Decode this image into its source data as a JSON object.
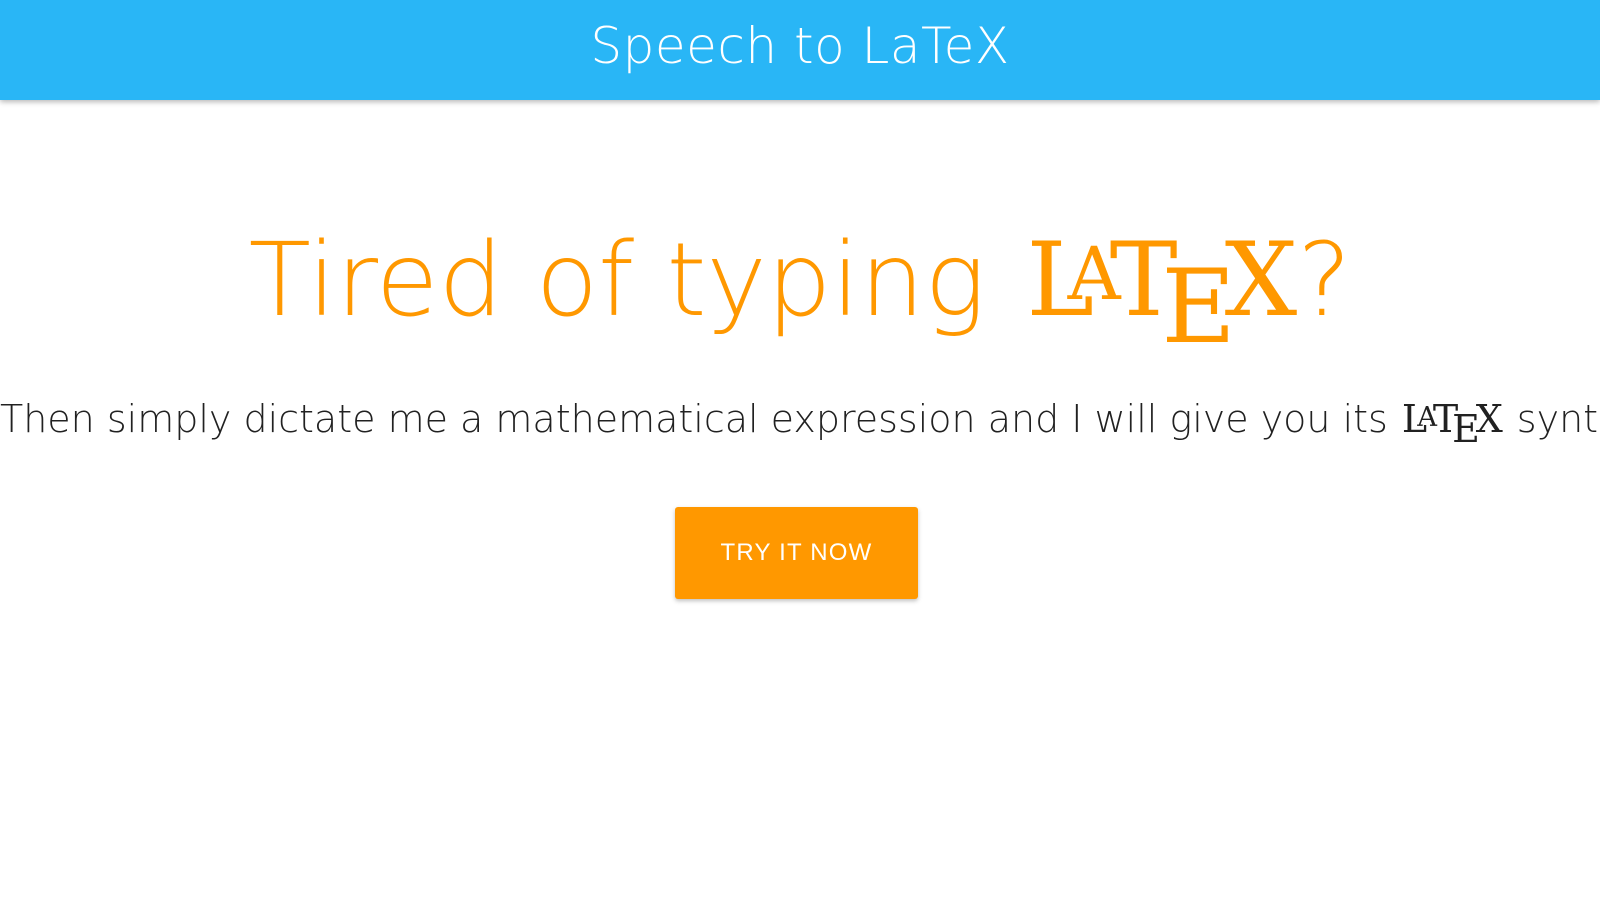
{
  "app_bar": {
    "title": "Speech to LaTeX"
  },
  "hero": {
    "headline_prefix": "Tired of typing ",
    "headline_suffix": "?",
    "subline_prefix": "Then simply dictate me a mathematical expression and I will give you its ",
    "subline_suffix": " syntax!",
    "latex_logo": {
      "l": "L",
      "a": "A",
      "t": "T",
      "e": "E",
      "x": "X"
    }
  },
  "cta": {
    "label": "TRY IT NOW"
  },
  "colors": {
    "app_bar": "#29b6f6",
    "accent": "#ff9800",
    "text": "#212121",
    "on_primary": "#ffffff"
  }
}
